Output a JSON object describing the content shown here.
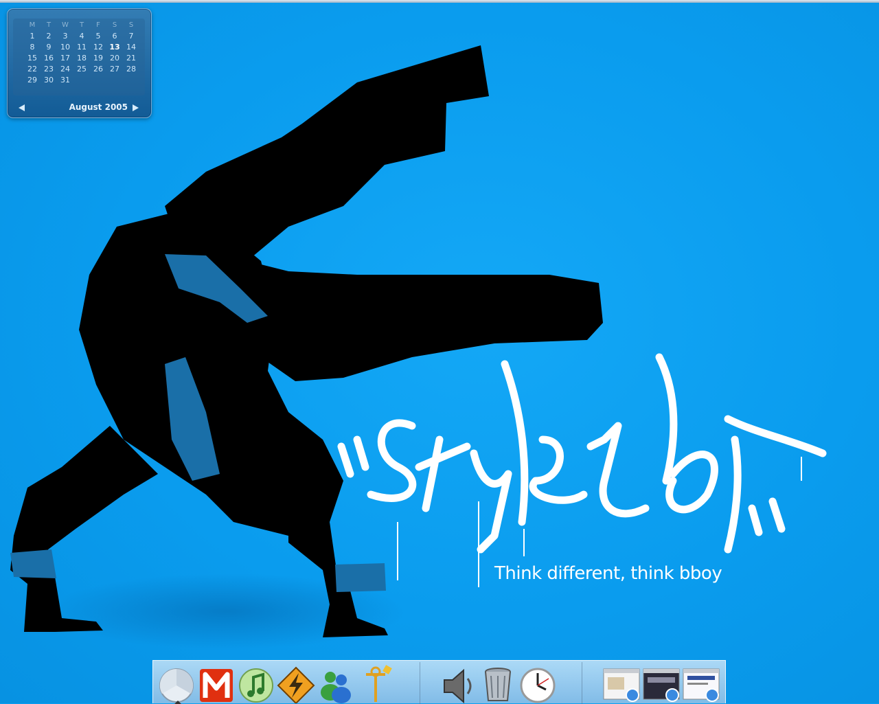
{
  "calendar": {
    "weekdays": [
      "M",
      "T",
      "W",
      "T",
      "F",
      "S",
      "S"
    ],
    "days": [
      "1",
      "2",
      "3",
      "4",
      "5",
      "6",
      "7",
      "8",
      "9",
      "10",
      "11",
      "12",
      "13",
      "14",
      "15",
      "16",
      "17",
      "18",
      "19",
      "20",
      "21",
      "22",
      "23",
      "24",
      "25",
      "26",
      "27",
      "28",
      "29",
      "30",
      "31"
    ],
    "today": "13",
    "month_label": "August",
    "year_label": "2005"
  },
  "wallpaper": {
    "tag": "\"StyleItOut\"",
    "tagline": "Think different, think bboy"
  },
  "dock": {
    "items": [
      {
        "name": "finder-icon"
      },
      {
        "name": "mail-icon"
      },
      {
        "name": "itunes-icon"
      },
      {
        "name": "winamp-icon"
      },
      {
        "name": "messenger-icon"
      },
      {
        "name": "network-icon"
      },
      {
        "name": "speaker-icon"
      },
      {
        "name": "trash-icon"
      },
      {
        "name": "clock-icon"
      },
      {
        "name": "browser-window-1"
      },
      {
        "name": "browser-window-2"
      },
      {
        "name": "browser-window-3"
      }
    ]
  }
}
